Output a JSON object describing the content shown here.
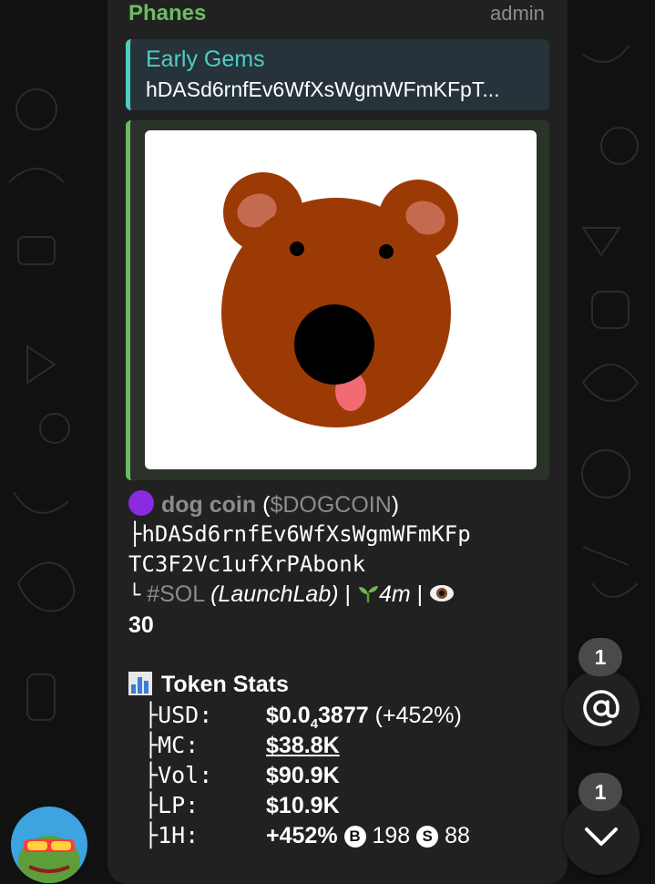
{
  "message": {
    "sender": "Phanes",
    "role": "admin",
    "reply": {
      "title": "Early Gems",
      "text": "hDASd6rnfEv6WfXsWgmWFmKFpT..."
    },
    "token": {
      "name": "dog coin",
      "ticker_open": "(",
      "ticker": "$DOGCOIN",
      "ticker_close": ")",
      "address_line1": "├hDASd6rnfEv6WfXsWgmWFmKFp",
      "address_line2": "TC3F2Vc1ufXrPAbonk",
      "meta_branch": "└",
      "chain": "#SOL",
      "platform": "(LaunchLab)",
      "sep1": "|",
      "age": "4m",
      "sep2": "|",
      "views": "30"
    },
    "stats": {
      "title": "Token Stats",
      "rows": [
        {
          "key": "USD:",
          "value_main": "$0.0",
          "value_sub": "4",
          "value_rest": "3877",
          "value_extra": "(+452%)"
        },
        {
          "key": "MC:",
          "value_main": "$38.8K"
        },
        {
          "key": "Vol:",
          "value_main": "$90.9K"
        },
        {
          "key": "LP:",
          "value_main": "$10.9K"
        },
        {
          "key": "1H:",
          "value_main": "+452%",
          "buys_icon": "B",
          "buys": "198",
          "sells_icon": "S",
          "sells": "88"
        }
      ]
    }
  },
  "mentions": {
    "count": "1",
    "icon": "at-icon"
  },
  "scroll_down": {
    "count": "1",
    "icon": "chevron-down-icon"
  },
  "colors": {
    "accent_green": "#6dbb62",
    "accent_teal": "#4ecdc4",
    "bubble": "#212121"
  }
}
